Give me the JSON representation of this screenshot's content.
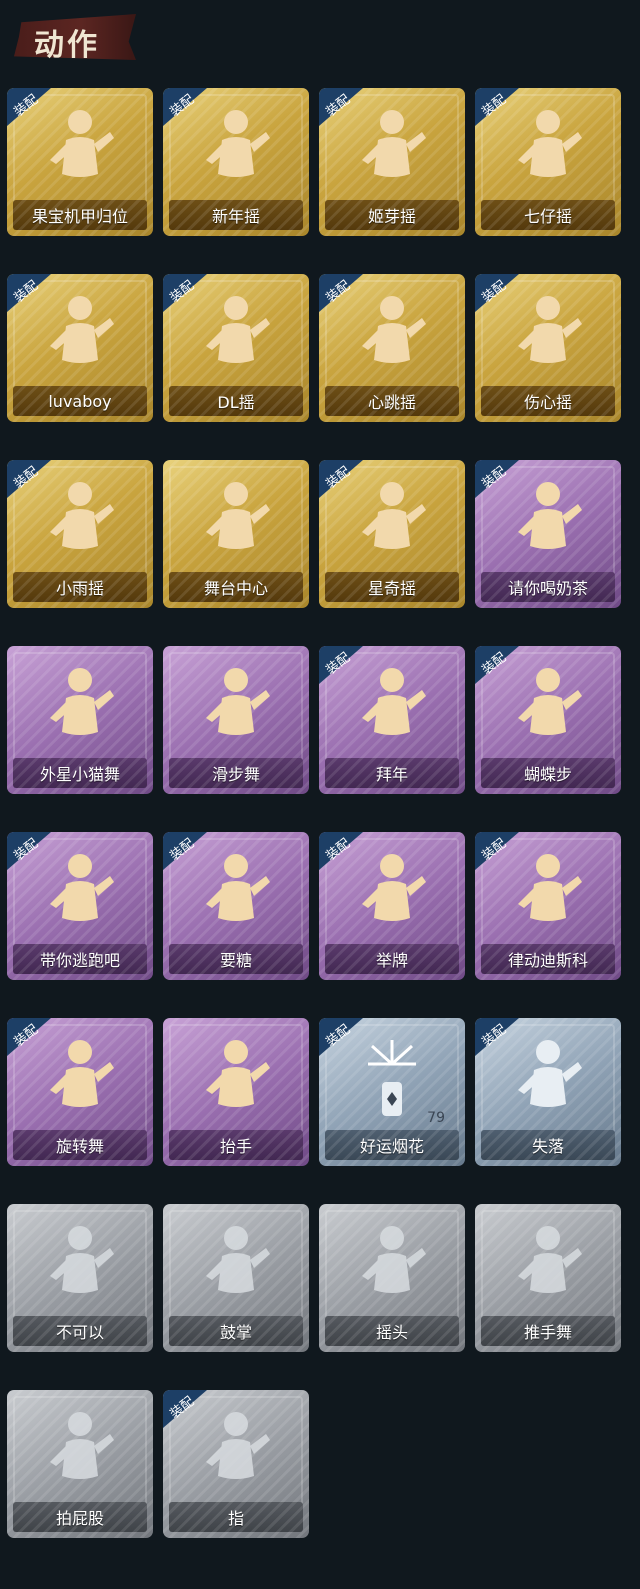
{
  "header": {
    "title": "动作"
  },
  "badge_text": "装配",
  "emotes": [
    {
      "label": "果宝机甲归位",
      "tier": "gold",
      "equipped": true,
      "icon": "dance-pose-icon"
    },
    {
      "label": "新年摇",
      "tier": "gold",
      "equipped": true,
      "icon": "dance-pose-icon"
    },
    {
      "label": "姬芽摇",
      "tier": "gold",
      "equipped": true,
      "icon": "dance-pose-icon"
    },
    {
      "label": "七仔摇",
      "tier": "gold",
      "equipped": true,
      "icon": "dance-pose-icon"
    },
    {
      "label": "luvaboy",
      "tier": "gold",
      "equipped": true,
      "icon": "dance-pose-icon"
    },
    {
      "label": "DL摇",
      "tier": "gold",
      "equipped": true,
      "icon": "dance-pose-icon"
    },
    {
      "label": "心跳摇",
      "tier": "gold",
      "equipped": true,
      "icon": "dance-pose-icon"
    },
    {
      "label": "伤心摇",
      "tier": "gold",
      "equipped": true,
      "icon": "heart-hands-icon"
    },
    {
      "label": "小雨摇",
      "tier": "gold",
      "equipped": true,
      "icon": "dance-pose-icon"
    },
    {
      "label": "舞台中心",
      "tier": "gold",
      "equipped": false,
      "icon": "dance-pose-icon"
    },
    {
      "label": "星奇摇",
      "tier": "gold",
      "equipped": true,
      "icon": "dance-pose-icon"
    },
    {
      "label": "请你喝奶茶",
      "tier": "purple",
      "equipped": true,
      "icon": "sign-hold-icon"
    },
    {
      "label": "外星小猫舞",
      "tier": "purple",
      "equipped": false,
      "icon": "dance-pose-icon"
    },
    {
      "label": "滑步舞",
      "tier": "purple",
      "equipped": false,
      "icon": "dance-pose-icon"
    },
    {
      "label": "拜年",
      "tier": "purple",
      "equipped": true,
      "icon": "bow-icon"
    },
    {
      "label": "蝴蝶步",
      "tier": "purple",
      "equipped": true,
      "icon": "dance-pose-icon"
    },
    {
      "label": "带你逃跑吧",
      "tier": "purple",
      "equipped": true,
      "icon": "dance-pose-icon"
    },
    {
      "label": "要糖",
      "tier": "purple",
      "equipped": true,
      "icon": "reach-out-icon"
    },
    {
      "label": "举牌",
      "tier": "purple",
      "equipped": true,
      "icon": "sign-hold-icon"
    },
    {
      "label": "律动迪斯科",
      "tier": "purple",
      "equipped": true,
      "icon": "disco-icon"
    },
    {
      "label": "旋转舞",
      "tier": "purple",
      "equipped": true,
      "icon": "spin-icon"
    },
    {
      "label": "抬手",
      "tier": "purple",
      "equipped": false,
      "icon": "raise-hand-icon"
    },
    {
      "label": "好运烟花",
      "tier": "blue",
      "equipped": true,
      "icon": "firework-icon",
      "count": "79"
    },
    {
      "label": "失落",
      "tier": "blue",
      "equipped": true,
      "icon": "crawl-icon"
    },
    {
      "label": "不可以",
      "tier": "gray",
      "equipped": false,
      "icon": "finger-wag-icon"
    },
    {
      "label": "鼓掌",
      "tier": "gray",
      "equipped": false,
      "icon": "clap-icon"
    },
    {
      "label": "摇头",
      "tier": "gray",
      "equipped": false,
      "icon": "head-shake-icon"
    },
    {
      "label": "推手舞",
      "tier": "gray",
      "equipped": false,
      "icon": "push-hands-icon"
    },
    {
      "label": "拍屁股",
      "tier": "gray",
      "equipped": false,
      "icon": "butt-slap-icon"
    },
    {
      "label": "指",
      "tier": "gray",
      "equipped": true,
      "icon": "point-icon"
    }
  ]
}
